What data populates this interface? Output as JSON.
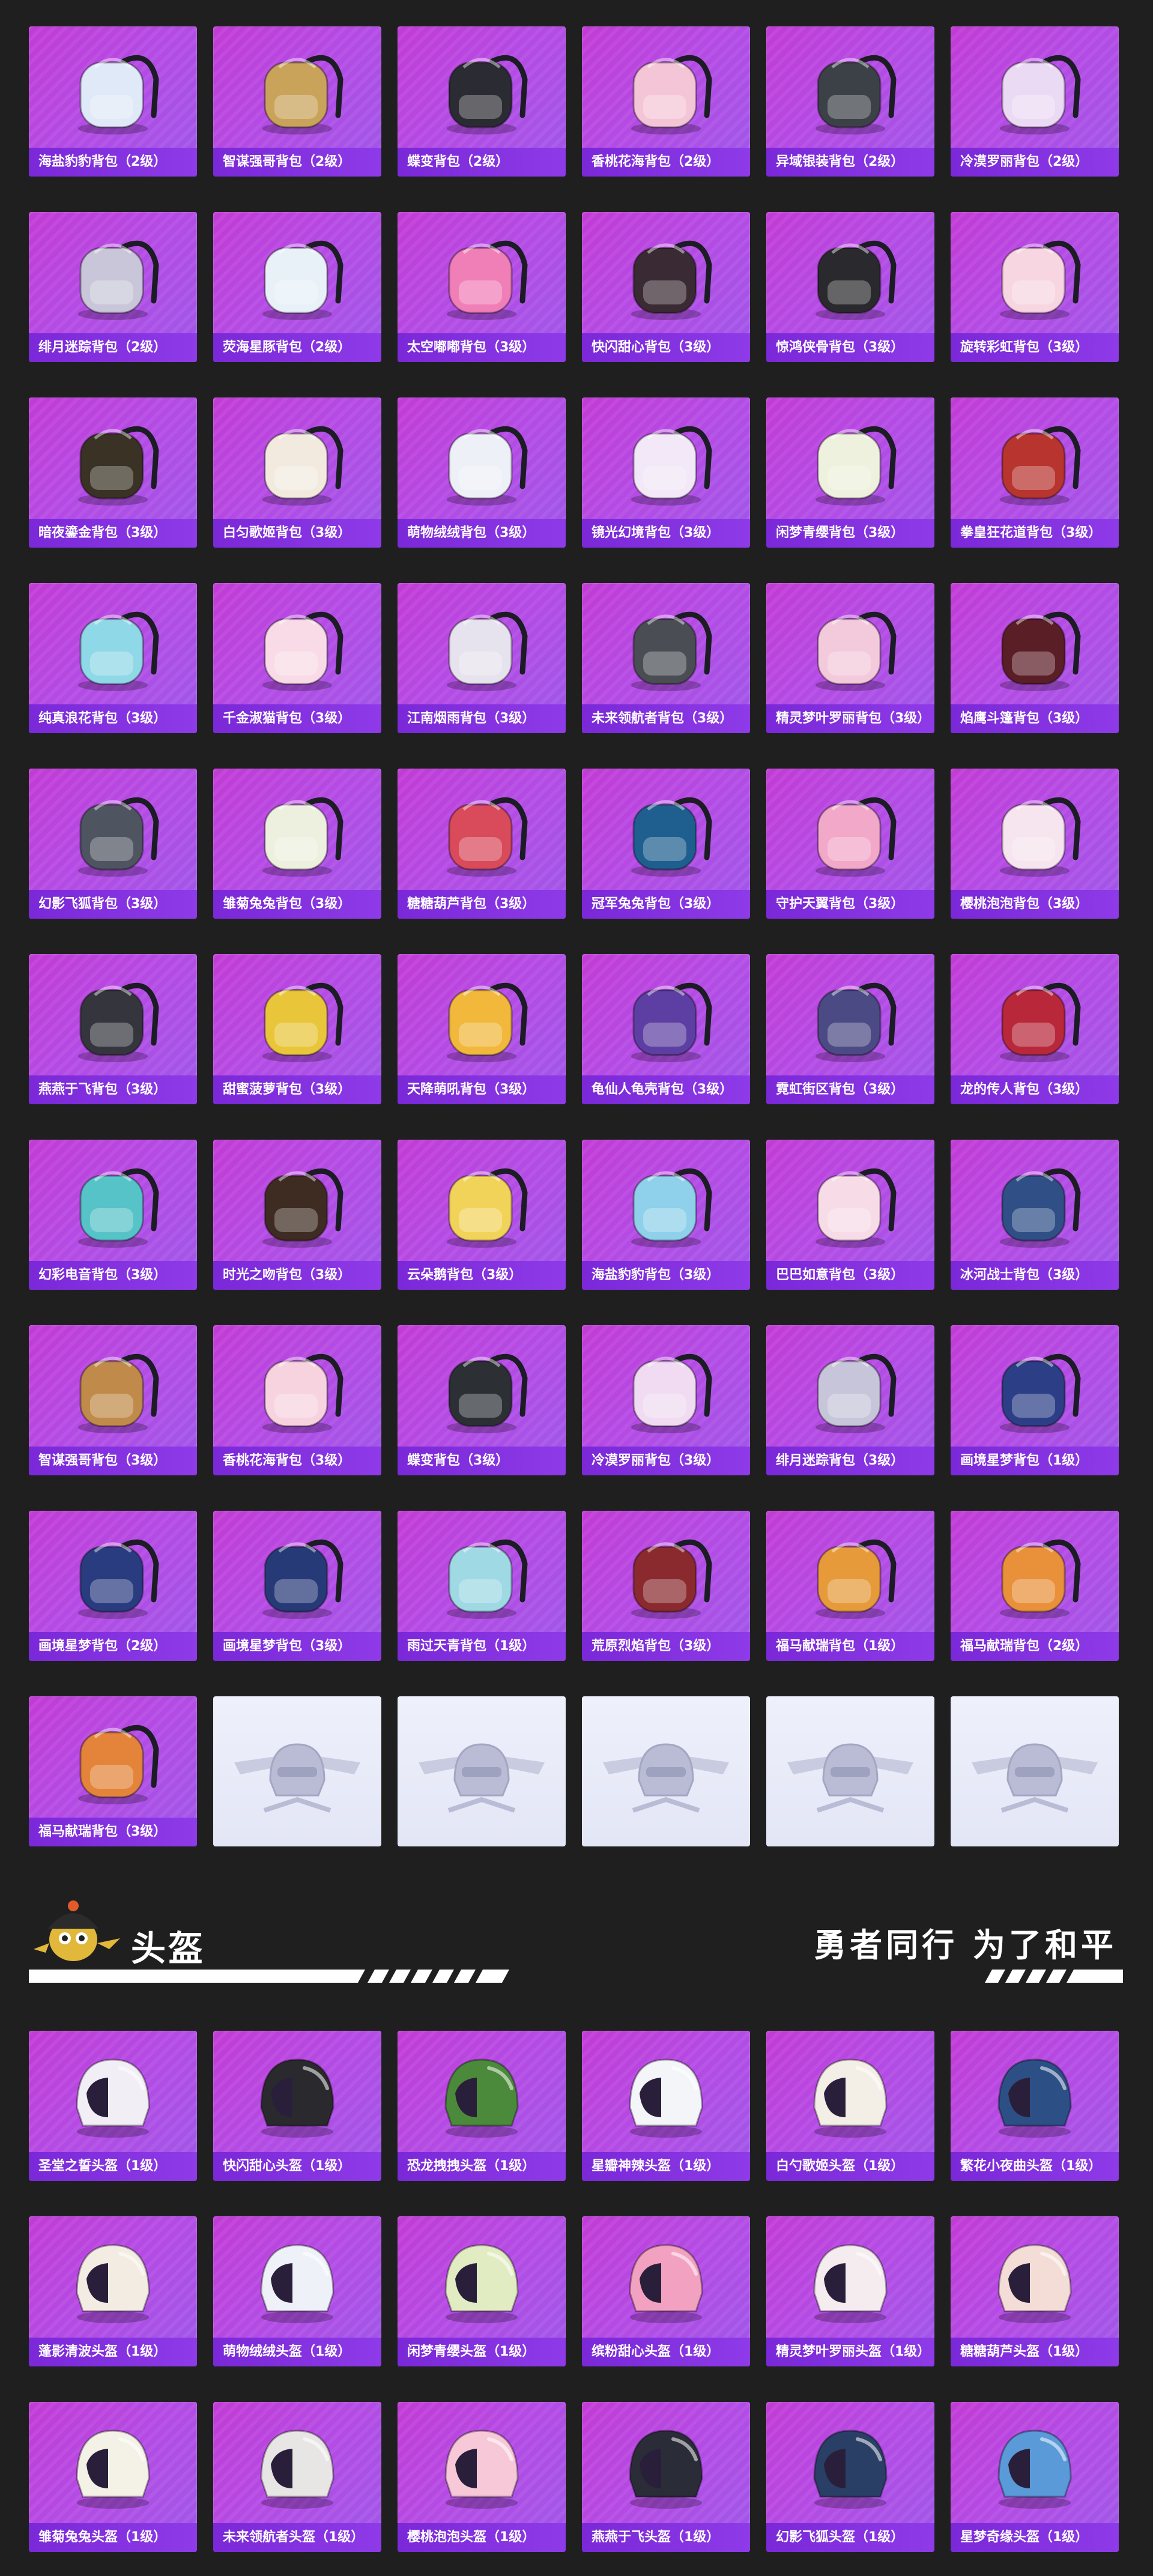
{
  "backpacks": [
    {
      "name": "海盐豹豹背包（2级）",
      "color": "#dfe9f7"
    },
    {
      "name": "智谋强哥背包（2级）",
      "color": "#c9a35a"
    },
    {
      "name": "蝶变背包（2级）",
      "color": "#2b2b33"
    },
    {
      "name": "香桃花海背包（2级）",
      "color": "#f4c5d6"
    },
    {
      "name": "异域银装背包（2级）",
      "color": "#3b4147"
    },
    {
      "name": "冷漠罗丽背包（2级）",
      "color": "#eadaf3"
    },
    {
      "name": "绯月迷踪背包（2级）",
      "color": "#c8c6d8"
    },
    {
      "name": "荧海星豚背包（2级）",
      "color": "#e8f1f8"
    },
    {
      "name": "太空嘟嘟背包（3级）",
      "color": "#f07fb8"
    },
    {
      "name": "快闪甜心背包（3级）",
      "color": "#3a2a33"
    },
    {
      "name": "惊鸿侠骨背包（3级）",
      "color": "#2a2a2e"
    },
    {
      "name": "旋转彩虹背包（3级）",
      "color": "#f7d6e2"
    },
    {
      "name": "暗夜鎏金背包（3级）",
      "color": "#3a3224"
    },
    {
      "name": "白匀歌姬背包（3级）",
      "color": "#f2eadf"
    },
    {
      "name": "萌物绒绒背包（3级）",
      "color": "#eef0f7"
    },
    {
      "name": "镜光幻境背包（3级）",
      "color": "#f2e8f7"
    },
    {
      "name": "闲梦青缨背包（3级）",
      "color": "#eef1dd"
    },
    {
      "name": "拳皇狂花道背包（3级）",
      "color": "#b8342f"
    },
    {
      "name": "纯真浪花背包（3级）",
      "color": "#8fd8e8"
    },
    {
      "name": "千金淑猫背包（3级）",
      "color": "#f8dbe6"
    },
    {
      "name": "江南烟雨背包（3级）",
      "color": "#e6e2ee"
    },
    {
      "name": "未来领航者背包（3级）",
      "color": "#4a4e54"
    },
    {
      "name": "精灵梦叶罗丽背包（3级）",
      "color": "#f3c9dc"
    },
    {
      "name": "焰鹰斗篷背包（3级）",
      "color": "#5a1e26"
    },
    {
      "name": "幻影飞狐背包（3级）",
      "color": "#4f5560"
    },
    {
      "name": "雏菊兔兔背包（3级）",
      "color": "#eef0df"
    },
    {
      "name": "糖糖葫芦背包（3级）",
      "color": "#d94a5a"
    },
    {
      "name": "冠军兔兔背包（3级）",
      "color": "#1f5f8f"
    },
    {
      "name": "守护天翼背包（3级）",
      "color": "#f2a8c8"
    },
    {
      "name": "樱桃泡泡背包（3级）",
      "color": "#f6e4ee"
    },
    {
      "name": "燕燕于飞背包（3级）",
      "color": "#35363d"
    },
    {
      "name": "甜蜜菠萝背包（3级）",
      "color": "#e9c53a"
    },
    {
      "name": "天降萌吼背包（3级）",
      "color": "#f1b83c"
    },
    {
      "name": "龟仙人龟壳背包（3级）",
      "color": "#5d3fa3"
    },
    {
      "name": "霓虹街区背包（3级）",
      "color": "#4b4a84"
    },
    {
      "name": "龙的传人背包（3级）",
      "color": "#b8283a"
    },
    {
      "name": "幻彩电音背包（3级）",
      "color": "#56c3c8"
    },
    {
      "name": "时光之吻背包（3级）",
      "color": "#3e2b22"
    },
    {
      "name": "云朵鹅背包（3级）",
      "color": "#f2d35a"
    },
    {
      "name": "海盐豹豹背包（3级）",
      "color": "#8fd0ea"
    },
    {
      "name": "巴巴如意背包（3级）",
      "color": "#f7dbe6"
    },
    {
      "name": "冰河战士背包（3级）",
      "color": "#2f4f86"
    },
    {
      "name": "智谋强哥背包（3级）",
      "color": "#c08b4a"
    },
    {
      "name": "香桃花海背包（3级）",
      "color": "#f7d3df"
    },
    {
      "name": "蝶变背包（3级）",
      "color": "#2c3035"
    },
    {
      "name": "冷漠罗丽背包（3级）",
      "color": "#f0dbf2"
    },
    {
      "name": "绯月迷踪背包（3级）",
      "color": "#c7c5d9"
    },
    {
      "name": "画境星梦背包（1级）",
      "color": "#2c3f86"
    },
    {
      "name": "画境星梦背包（2级）",
      "color": "#2a3c80"
    },
    {
      "name": "画境星梦背包（3级）",
      "color": "#273a78"
    },
    {
      "name": "雨过天青背包（1级）",
      "color": "#9fd9e4"
    },
    {
      "name": "荒原烈焰背包（3级）",
      "color": "#8a2a2f"
    },
    {
      "name": "福马献瑞背包（1级）",
      "color": "#e79a3a"
    },
    {
      "name": "福马献瑞背包（2级）",
      "color": "#e9903a"
    },
    {
      "name": "福马献瑞背包（3级）",
      "color": "#e4843a"
    }
  ],
  "empty_slots": 5,
  "helmet_section": {
    "title": "头盔",
    "slogan": "勇者同行 为了和平"
  },
  "helmets": [
    {
      "name": "圣堂之誓头盔（1级）",
      "color": "#f2eef5"
    },
    {
      "name": "快闪甜心头盔（1级）",
      "color": "#2a2a2e"
    },
    {
      "name": "恐龙拽拽头盔（1级）",
      "color": "#4a8a3a"
    },
    {
      "name": "星瓣神辣头盔（1级）",
      "color": "#f3f5f8"
    },
    {
      "name": "白勺歌姬头盔（1级）",
      "color": "#f4efe6"
    },
    {
      "name": "繁花小夜曲头盔（1级）",
      "color": "#2c4f86"
    },
    {
      "name": "蓬影清波头盔（1级）",
      "color": "#f2ece2"
    },
    {
      "name": "萌物绒绒头盔（1级）",
      "color": "#eef2f8"
    },
    {
      "name": "闲梦青缨头盔（1级）",
      "color": "#e2ecc3"
    },
    {
      "name": "缤粉甜心头盔（1级）",
      "color": "#f2a2c0"
    },
    {
      "name": "精灵梦叶罗丽头盔（1级）",
      "color": "#f4ecef"
    },
    {
      "name": "糖糖葫芦头盔（1级）",
      "color": "#f3ddd6"
    },
    {
      "name": "雏菊兔兔头盔（1级）",
      "color": "#f4f2e6"
    },
    {
      "name": "未来领航者头盔（1级）",
      "color": "#e8e6e4"
    },
    {
      "name": "樱桃泡泡头盔（1级）",
      "color": "#f7c9d8"
    },
    {
      "name": "燕燕于飞头盔（1级）",
      "color": "#2a2c38"
    },
    {
      "name": "幻影飞狐头盔（1级）",
      "color": "#2a3f66"
    },
    {
      "name": "星梦奇缘头盔（1级）",
      "color": "#5a9ad8"
    }
  ]
}
